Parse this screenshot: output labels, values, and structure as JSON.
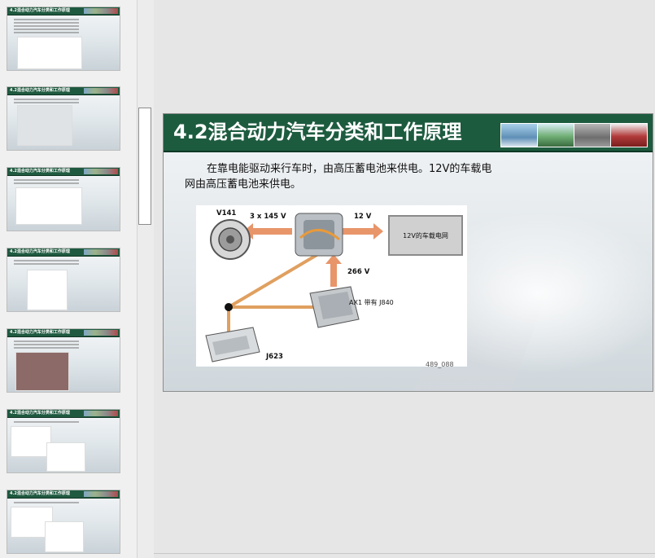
{
  "thumbnails": [
    {
      "title": "4.2混合动力汽车分类和工作原理",
      "lines": 5
    },
    {
      "title": "4.2混合动力汽车分类和工作原理",
      "lines": 2
    },
    {
      "title": "4.2混合动力汽车分类和工作原理",
      "lines": 2
    },
    {
      "title": "4.2混合动力汽车分类和工作原理",
      "lines": 2
    },
    {
      "title": "4.2混合动力汽车分类和工作原理",
      "lines": 3
    },
    {
      "title": "4.2混合动力汽车分类和工作原理",
      "lines": 1
    },
    {
      "title": "4.2混合动力汽车分类和工作原理",
      "lines": 1
    }
  ],
  "slide": {
    "title": "4.2混合动力汽车分类和工作原理",
    "body": "在靠电能驱动来行车时，由高压蓄电池来供电。12V的车载电网由高压蓄电池来供电。",
    "diagram": {
      "v141": "V141",
      "voltage_3x145": "3 x 145 V",
      "voltage_12": "12 V",
      "box_12v": "12V的车载电网",
      "voltage_266": "266 V",
      "ax1": "AX1 带有 J840",
      "j623": "J623",
      "figure_no": "489_088"
    }
  },
  "colors": {
    "title_bar": "#1d5b3f",
    "arrow": "#e8956a",
    "wire": "#e0a060"
  }
}
